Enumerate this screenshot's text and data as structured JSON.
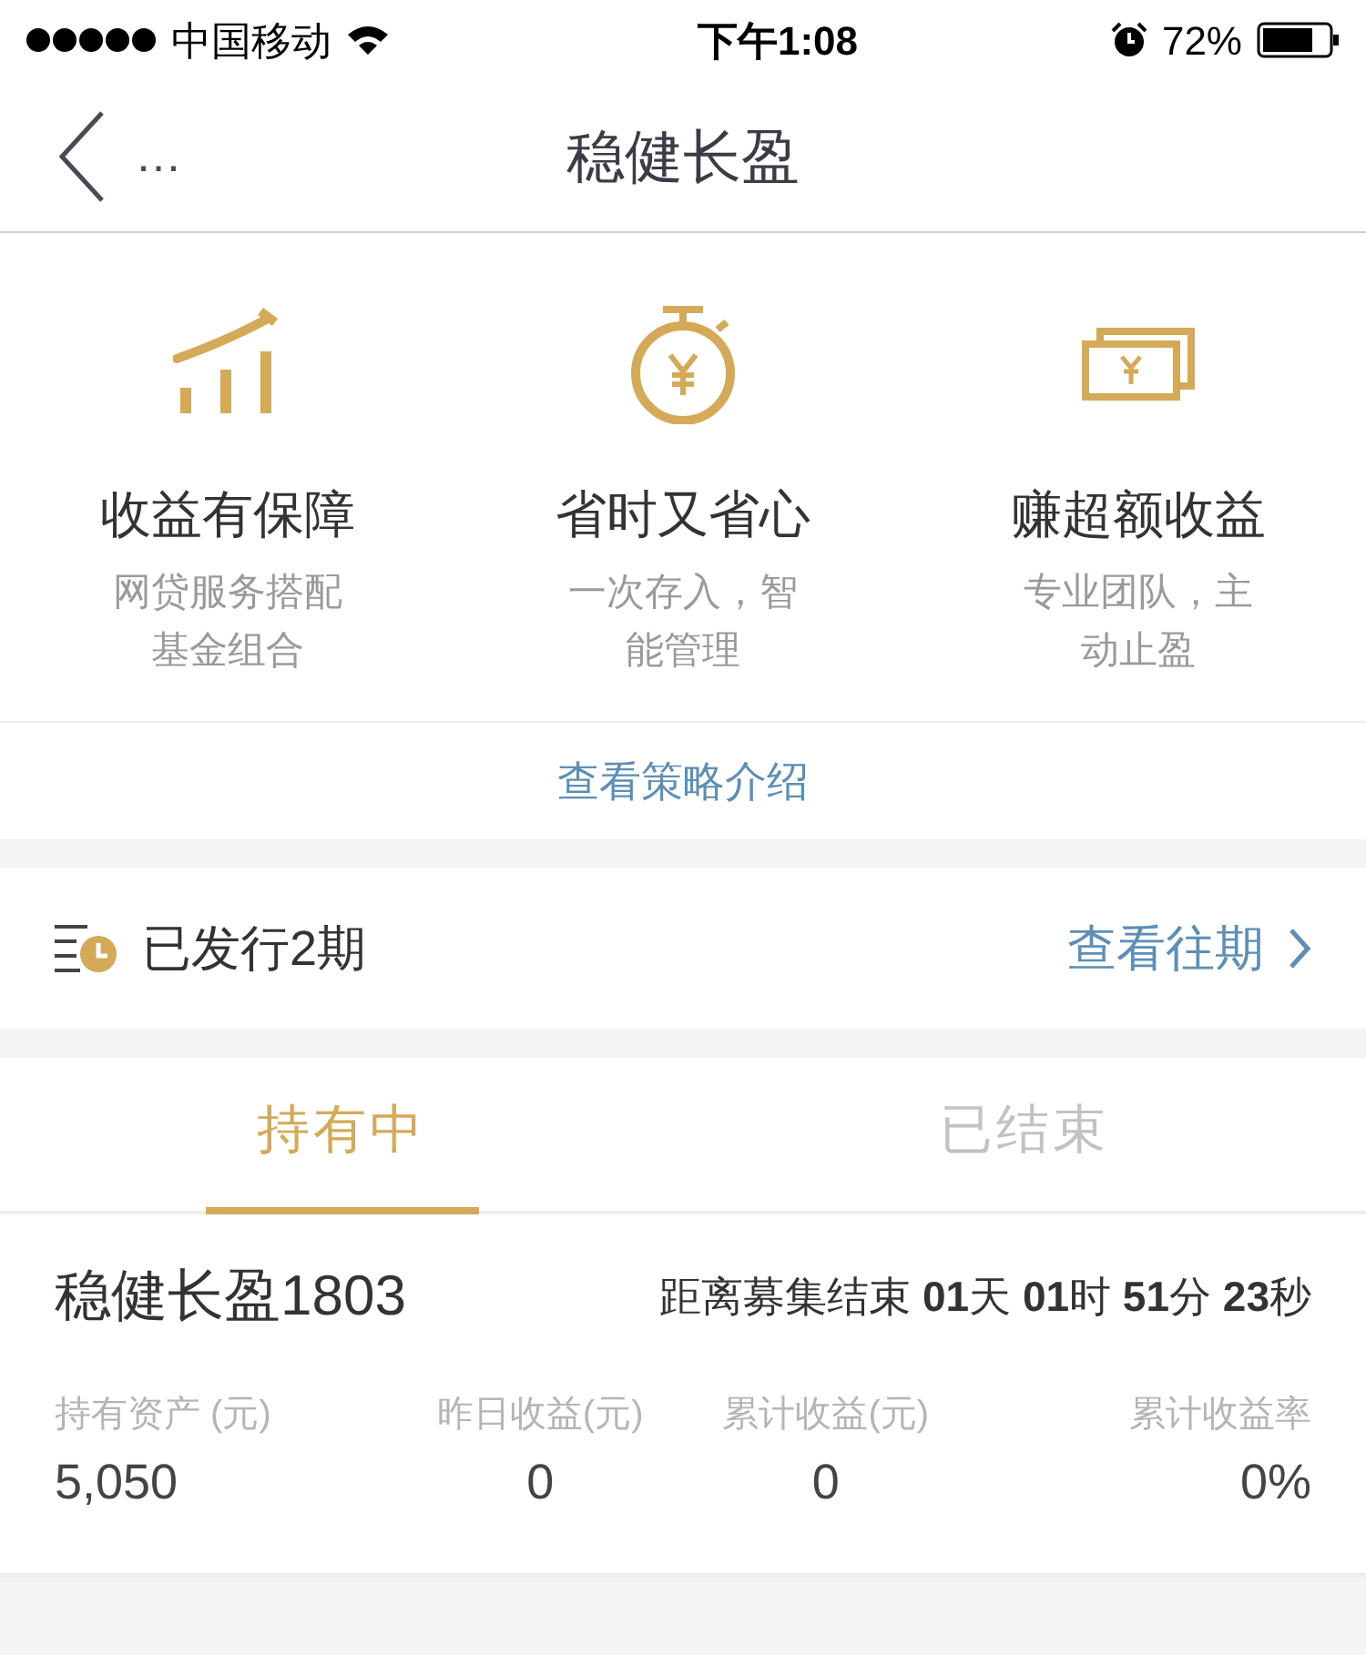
{
  "status_bar": {
    "carrier": "中国移动",
    "time": "下午1:08",
    "battery": "72%"
  },
  "nav": {
    "more": "…",
    "title": "稳健长盈"
  },
  "features": [
    {
      "kind": "chart",
      "title": "收益有保障",
      "desc": "网贷服务搭配基金组合"
    },
    {
      "kind": "timer",
      "title": "省时又省心",
      "desc": "一次存入，智能管理"
    },
    {
      "kind": "cash",
      "title": "赚超额收益",
      "desc": "专业团队，主动止盈"
    }
  ],
  "strategy_link": "查看策略介绍",
  "issues": {
    "label": "已发行2期",
    "link": "查看往期"
  },
  "tabs": [
    {
      "label": "持有中",
      "selected": true
    },
    {
      "label": "已结束",
      "selected": false
    }
  ],
  "holding": {
    "name": "稳健长盈1803",
    "countdown": "距离募集结束 **01**天 **01**时 **51**分 **23**秒",
    "stats": [
      {
        "label": "持有资产 (元)",
        "value": "5,050"
      },
      {
        "label": "昨日收益(元)",
        "value": "0"
      },
      {
        "label": "累计收益(元)",
        "value": "0"
      },
      {
        "label": "累计收益率",
        "value": "0%"
      }
    ]
  }
}
